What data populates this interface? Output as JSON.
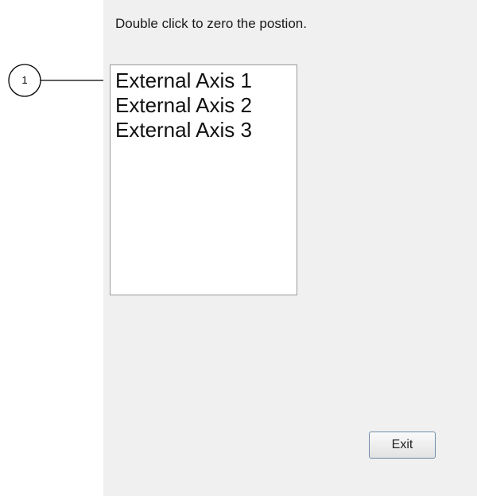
{
  "dialog": {
    "instruction": "Double click to zero the postion.",
    "axes": [
      "External Axis 1",
      "External Axis 2",
      "External Axis 3"
    ],
    "exit_label": "Exit"
  },
  "callout": {
    "number": "1"
  }
}
